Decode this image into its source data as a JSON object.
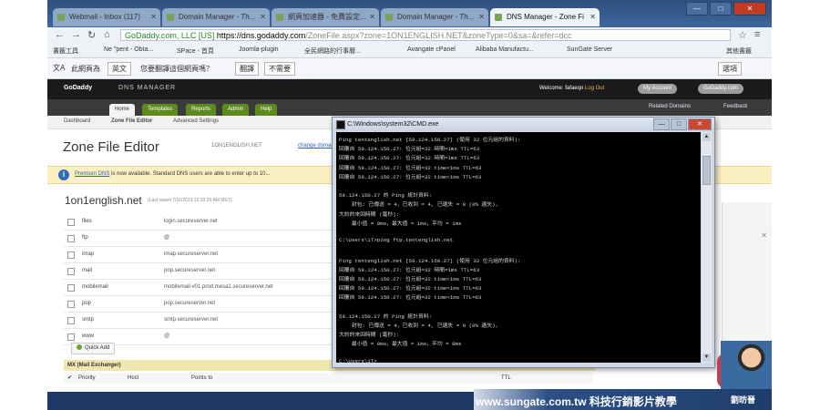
{
  "browser": {
    "tabs": [
      {
        "label": "Webmail - Inbox (117)"
      },
      {
        "label": "Domain Manager - Th..."
      },
      {
        "label": "網頁加速器 - 免費設定..."
      },
      {
        "label": "Domain Manager - Th..."
      },
      {
        "label": "DNS Manager - Zone Fi",
        "active": true
      }
    ],
    "url": {
      "secure": "GoDaddy.com, LLC [US]",
      "host": "https://dns.godaddy.com",
      "path": "/ZoneFile.aspx?zone=1ON1ENGLISH.NET&zoneType=0&sa=&refer=dcc"
    },
    "bookmarks": [
      "書籤工具",
      "Ne \"pent - Obta...",
      "SPace - 首頁",
      "Joomla-plugin",
      "全民網路的行事曆...",
      "Avangate cPanel",
      "Alibaba Manufactu...",
      "SunGate Server",
      "其他書籤"
    ],
    "translate": {
      "detected": "此網頁為",
      "lang": "英文",
      "question": "您要翻譯這個網頁嗎？",
      "translate_btn": "翻譯",
      "no_btn": "不需要",
      "options": "選項"
    }
  },
  "site": {
    "logo": "GoDaddy",
    "app": "DNS MANAGER",
    "welcome": "Welcome: fafaeqo",
    "logout": "Log Out",
    "my_account": "My Account",
    "visit": "GoDaddy.com",
    "nav": [
      "Home",
      "Templates",
      "Reports",
      "Admin",
      "Help"
    ],
    "help_domains": "Related Domains",
    "feedback": "Feedback",
    "subnav": [
      "Dashboard",
      "Zone File Editor",
      "Advanced Settings"
    ],
    "zone_title": "Zone File Editor",
    "domain_small": "1ON1ENGLISH.NET",
    "change_link": "change domain",
    "promo_link": "Premium DNS",
    "promo_text": " is now available. Standard DNS users are able to enter up to 10...",
    "domain_title": "1on1english.net",
    "last_saved": "(Last saved 7/16/2013 12:33:25 AM MST)",
    "records": [
      {
        "host": "files",
        "points": "login.secureserver.net"
      },
      {
        "host": "ftp",
        "points": "@"
      },
      {
        "host": "imap",
        "points": "imap.secureserver.net"
      },
      {
        "host": "mail",
        "points": "pop.secureserver.net"
      },
      {
        "host": "mobilemail",
        "points": "mobilemail-v01.prod.mesa1.secureserver.net"
      },
      {
        "host": "pop",
        "points": "pop.secureserver.net"
      },
      {
        "host": "smtp",
        "points": "smtp.secureserver.net"
      },
      {
        "host": "www",
        "points": "@"
      }
    ],
    "quick_add": "Quick Add",
    "mx_header": "MX (Mail Exchanger)",
    "mx_cols": [
      "Priority",
      "Host",
      "Points to",
      "TTL"
    ]
  },
  "cmd": {
    "title": "C:\\Windows\\system32\\CMD.exe",
    "lines": [
      "Ping tentenglish.net [59.124.150.27] (使用 32 位元組的資料):",
      "回覆自 59.124.150.27: 位元組=32 時間=1ms TTL=63",
      "回覆自 59.124.150.27: 位元組=32 時間=1ms TTL=63",
      "回覆自 59.124.150.27: 位元組=32 time<1ms TTL=63",
      "回覆自 59.124.150.27: 位元組=32 time<1ms TTL=63",
      "",
      "59.124.150.27 的 Ping 統計資料:",
      "    封包: 已傳送 = 4，已收到 = 4, 已遺失 = 0 (0% 遺失)，",
      "大約的來回時間 (毫秒):",
      "    最小值 = 0ms，最大值 = 1ms，平均 = 1ms",
      "",
      "C:\\Users\\1T>ping ftp.tentenglish.net",
      "",
      "Ping tentenglish.net [59.124.150.27] (使用 32 位元組的資料):",
      "回覆自 59.124.150.27: 位元組=32 時間=1ms TTL=63",
      "回覆自 59.124.150.27: 位元組=32 time<1ms TTL=63",
      "回覆自 59.124.150.27: 位元組=32 time<1ms TTL=63",
      "回覆自 59.124.150.27: 位元組=32 time<1ms TTL=63",
      "",
      "59.124.150.27 的 Ping 統計資料:",
      "    封包: 已傳送 = 4，已收到 = 4, 已遺失 = 0 (0% 遺失)，",
      "大約的來回時間 (毫秒):",
      "    最小值 = 0ms，最大值 = 1ms，平均 = 0ms",
      "",
      "C:\\Users\\1T>"
    ]
  },
  "banner": {
    "text": "www.sungate.com.tw 科技行銷影片教學",
    "presenter": "劉昉晉"
  },
  "colors": {
    "accent": "#5d8a1e",
    "cmd_bg": "#000000",
    "banner": "#2b4f86"
  }
}
